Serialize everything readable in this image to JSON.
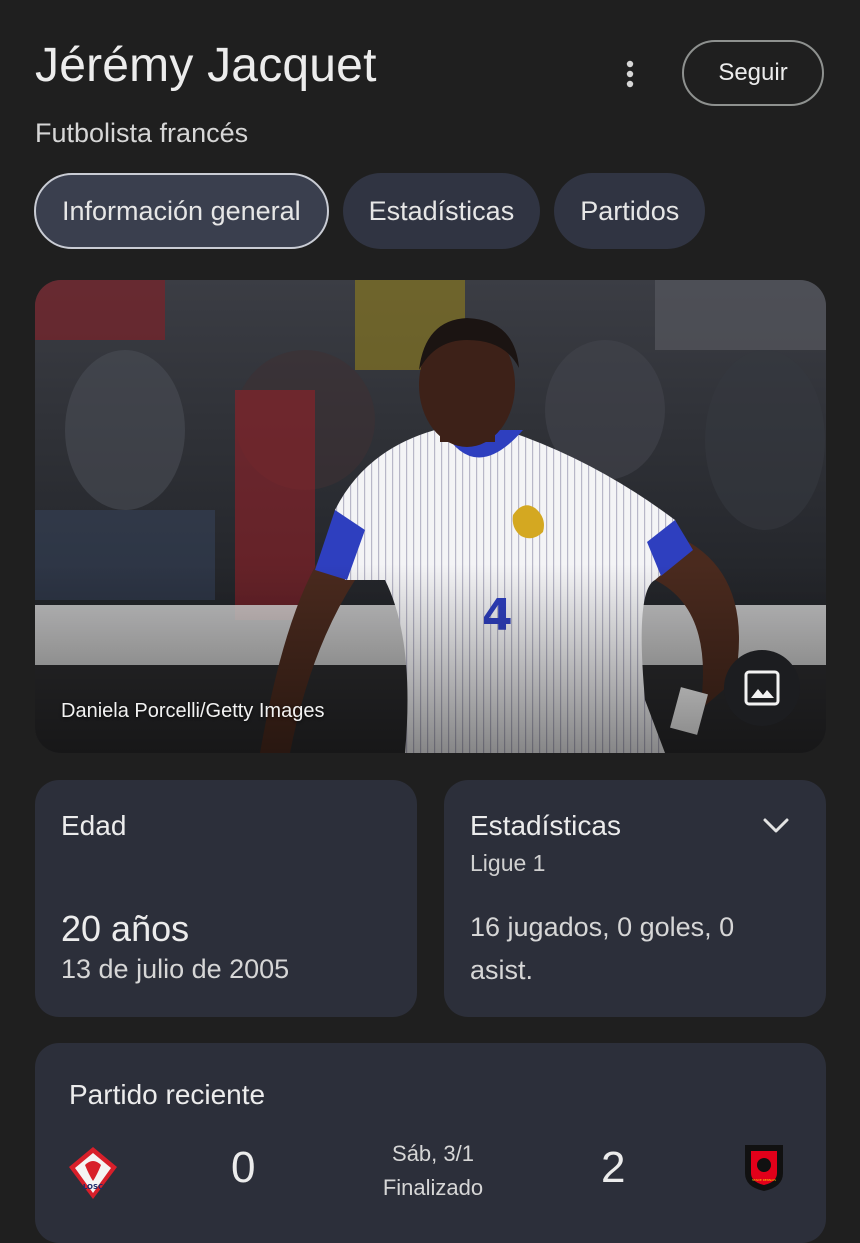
{
  "header": {
    "name": "Jérémy Jacquet",
    "subtitle": "Futbolista francés",
    "follow_label": "Seguir",
    "more_icon": "more-vert-icon"
  },
  "tabs": [
    {
      "label": "Información general",
      "active": true
    },
    {
      "label": "Estadísticas",
      "active": false
    },
    {
      "label": "Partidos",
      "active": false
    }
  ],
  "photo": {
    "credit": "Daniela Porcelli/Getty Images",
    "image_icon": "image-icon",
    "jersey_number": "4"
  },
  "age_card": {
    "label": "Edad",
    "value": "20 años",
    "birth_date": "13 de julio de 2005"
  },
  "stats_card": {
    "label": "Estadísticas",
    "league": "Ligue 1",
    "summary": "16 jugados, 0 goles, 0 asist.",
    "expand_icon": "chevron-down-icon"
  },
  "recent_match": {
    "title": "Partido reciente",
    "home_team_logo_text": "LOSC",
    "home_score": "0",
    "date": "Sáb, 3/1",
    "status": "Finalizado",
    "away_score": "2",
    "away_team_logo_text": "STADE RENNAIS"
  },
  "colors": {
    "background": "#1f1f1f",
    "card": "#2c2f3a",
    "tab": "#303442",
    "lille_red": "#d81f2a",
    "rennes_red": "#e2001a"
  }
}
